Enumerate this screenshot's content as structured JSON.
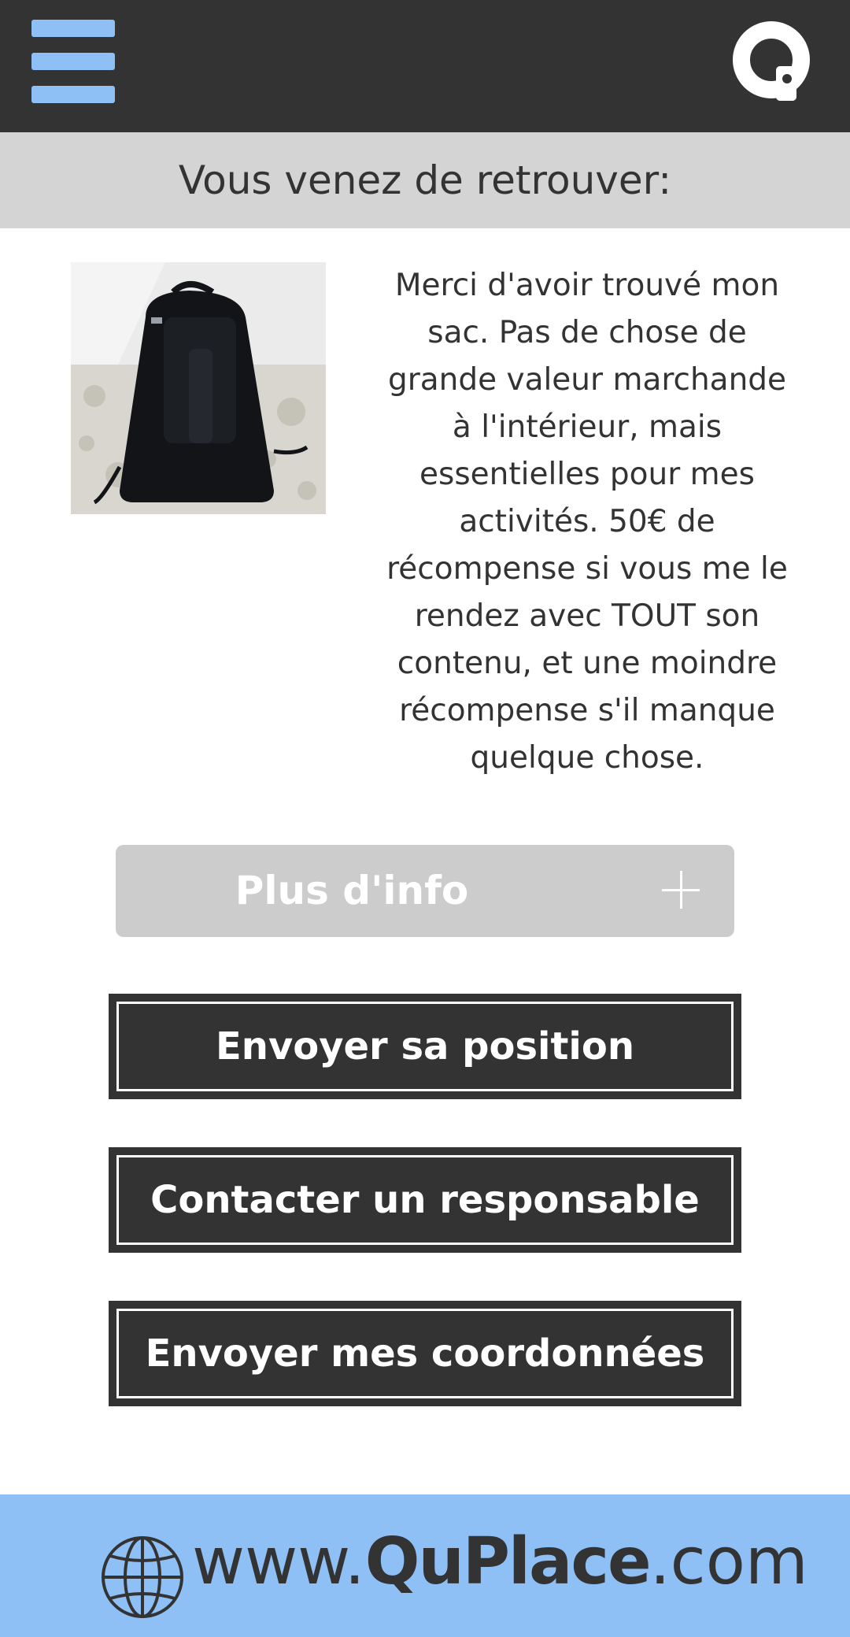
{
  "header": {
    "menu_icon": "hamburger-menu-icon",
    "logo_icon": "quplace-q-logo-icon"
  },
  "heading": {
    "title": "Vous venez de retrouver:"
  },
  "item": {
    "photo": "black-backpack-photo",
    "description": "Merci d'avoir trouvé mon sac. Pas de chose de grande valeur marchande à l'intérieur, mais essentielles pour mes activités. 50€ de récompense si vous me le rendez avec TOUT son contenu, et une moindre récompense s'il manque quelque chose."
  },
  "buttons": {
    "more_info": "Plus d'info",
    "send_position": "Envoyer sa position",
    "contact_manager": "Contacter un responsable",
    "send_details": "Envoyer mes coordonnées"
  },
  "footer": {
    "url_prefix": "www.",
    "url_brand": "QuPlace",
    "url_suffix": ".com",
    "globe_icon": "globe-icon"
  },
  "colors": {
    "dark": "#333333",
    "accent_blue": "#8ec0f6",
    "heading_gray": "#d4d4d4",
    "info_button_gray": "#cccccc"
  }
}
